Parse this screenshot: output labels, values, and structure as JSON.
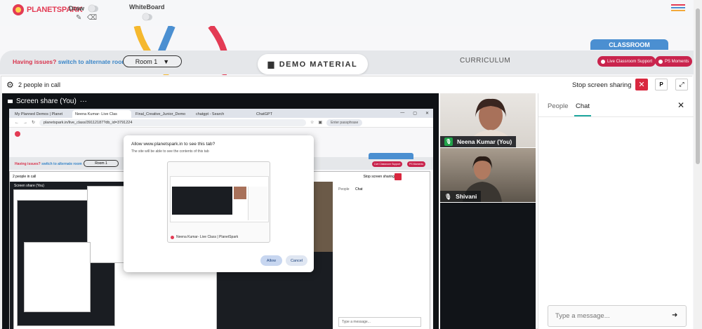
{
  "brand": {
    "name": "PLANETSPARK"
  },
  "header": {
    "draw_label": "Draw",
    "whiteboard_label": "WhiteBoard"
  },
  "toolbar": {
    "issue_text": "Having issues?",
    "alt_link": "switch to alternate room",
    "room_value": "Room 1",
    "demo_material": "DEMO MATERIAL",
    "curriculum": "CURRICULUM",
    "classroom": "CLASSROOM",
    "live_support": "Live Classroom Support",
    "ps_moments": "PS Moments"
  },
  "call": {
    "people_count": "2 people in call",
    "stop_sharing": "Stop screen sharing",
    "p_label": "P",
    "share_title": "Screen share (You)"
  },
  "shared_browser": {
    "tabs": [
      "My Planned Demos | Planet",
      "Neena Kumar- Live Clas",
      "Final_Creative_Junior_Demo",
      "chatgpt - Search",
      "ChatGPT"
    ],
    "url": "planetspark.in/live_class/39112187?db_id=3791224",
    "passphrase": "Enter passphrase",
    "inner_people": "2 people in call",
    "inner_stop": "Stop screen sharing",
    "inner_share": "Screen share (You)",
    "inner_people_tab": "People",
    "inner_chat_tab": "Chat",
    "inner_input": "Type a message...",
    "inner_issue": "Having issues?",
    "inner_alt": "switch to alternate room",
    "inner_room": "Room 1",
    "inner_live": "Live Classroom Support",
    "inner_ps": "PS Moments"
  },
  "dialog": {
    "title": "Allow www.planetspark.in to see this tab?",
    "subtitle": "The site will be able to see the contents of this tab",
    "tab_label": "Neena Kumar- Live Class | PlanetSpark",
    "allow": "Allow",
    "cancel": "Cancel"
  },
  "participants": [
    {
      "name": "Neena Kumar (You)"
    },
    {
      "name": "Shivani"
    }
  ],
  "chat": {
    "tab_people": "People",
    "tab_chat": "Chat",
    "placeholder": "Type a message..."
  },
  "colors": {
    "brand_red": "#e33b54",
    "link_blue": "#3a86c8",
    "classroom_blue": "#4b8fd1",
    "pill_crimson": "#c9244d",
    "stop_red": "#d9273f",
    "chat_accent": "#20a8a0"
  },
  "icons": [
    "gear-icon",
    "folder-icon",
    "pencil-icon",
    "eraser-icon",
    "hamburger-menu-icon",
    "close-icon",
    "expand-icon",
    "send-icon",
    "mic-icon"
  ]
}
